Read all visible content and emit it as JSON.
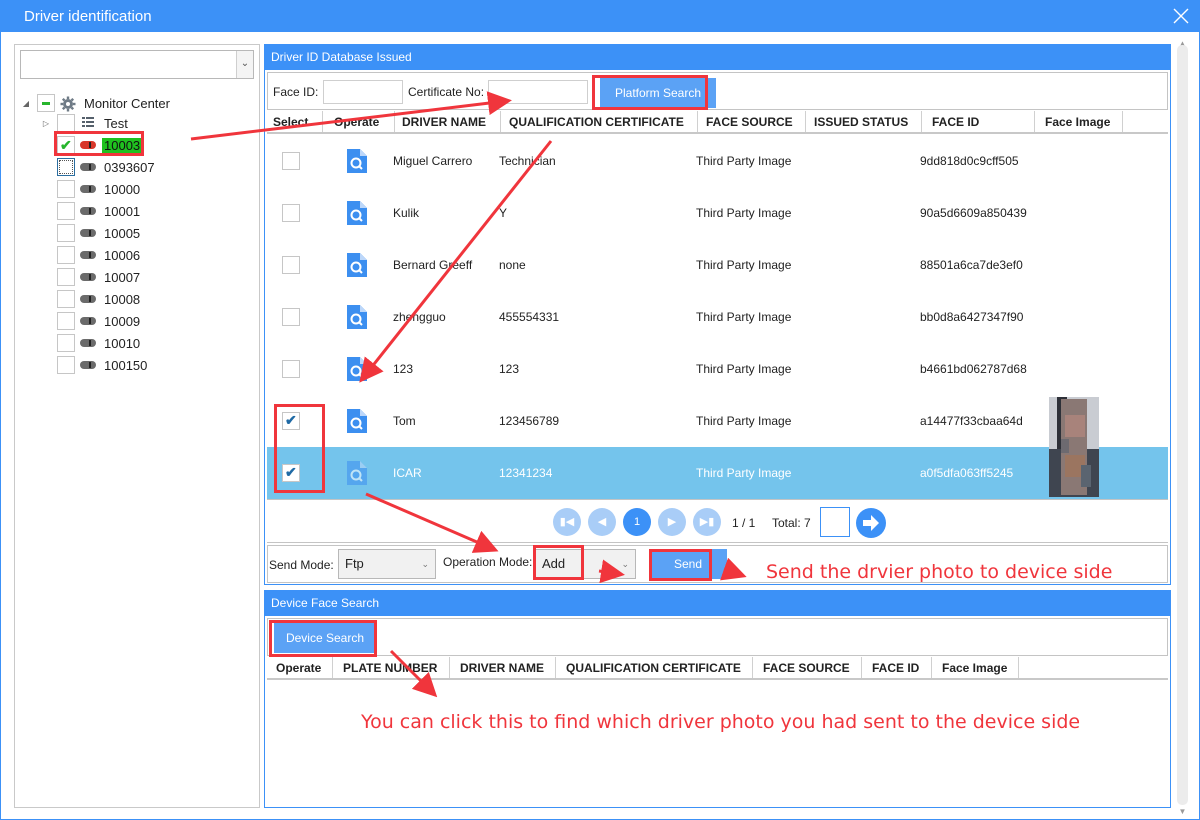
{
  "window": {
    "title": "Driver identification",
    "close_icon": "close-icon"
  },
  "left_panel": {
    "combo_value": "",
    "tree": {
      "root": {
        "label": "Monitor Center",
        "icon": "gear-icon",
        "state": "partial"
      },
      "items": [
        {
          "label": "Test",
          "icon": "list-icon",
          "state": "unchecked",
          "expandable": true
        },
        {
          "label": "10003",
          "icon": "car-icon-online",
          "state": "checked",
          "highlighted": true
        },
        {
          "label": "0393607",
          "icon": "car-icon",
          "state": "focused"
        },
        {
          "label": "10000",
          "icon": "car-icon",
          "state": "unchecked"
        },
        {
          "label": "10001",
          "icon": "car-icon",
          "state": "unchecked"
        },
        {
          "label": "10005",
          "icon": "car-icon",
          "state": "unchecked"
        },
        {
          "label": "10006",
          "icon": "car-icon",
          "state": "unchecked"
        },
        {
          "label": "10007",
          "icon": "car-icon",
          "state": "unchecked"
        },
        {
          "label": "10008",
          "icon": "car-icon",
          "state": "unchecked"
        },
        {
          "label": "10009",
          "icon": "car-icon",
          "state": "unchecked"
        },
        {
          "label": "10010",
          "icon": "car-icon",
          "state": "unchecked"
        },
        {
          "label": "100150",
          "icon": "car-icon",
          "state": "unchecked"
        }
      ]
    }
  },
  "db_panel": {
    "title": "Driver ID Database Issued",
    "face_id_label": "Face ID:",
    "face_id_value": "",
    "cert_label": "Certificate No:",
    "cert_value": "",
    "platform_search_label": "Platform Search",
    "columns": [
      "Select",
      "Operate",
      "DRIVER NAME",
      "QUALIFICATION CERTIFICATE",
      "FACE SOURCE",
      "ISSUED STATUS",
      "FACE ID",
      "Face Image"
    ],
    "rows": [
      {
        "checked": false,
        "name": "Miguel Carrero",
        "cert": "Technician",
        "source": "Third Party Image",
        "status": "",
        "face_id": "9dd818d0c9cff505",
        "has_image": false,
        "selected": false
      },
      {
        "checked": false,
        "name": "Kulik",
        "cert": "Y",
        "source": "Third Party Image",
        "status": "",
        "face_id": "90a5d6609a850439",
        "has_image": false,
        "selected": false
      },
      {
        "checked": false,
        "name": "Bernard Greeff",
        "cert": "none",
        "source": "Third Party Image",
        "status": "",
        "face_id": "88501a6ca7de3ef0",
        "has_image": false,
        "selected": false
      },
      {
        "checked": false,
        "name": "zhengguo",
        "cert": "455554331",
        "source": "Third Party Image",
        "status": "",
        "face_id": "bb0d8a6427347f90",
        "has_image": false,
        "selected": false
      },
      {
        "checked": false,
        "name": "123",
        "cert": "123",
        "source": "Third Party Image",
        "status": "",
        "face_id": "b4661bd062787d68",
        "has_image": false,
        "selected": false
      },
      {
        "checked": true,
        "name": "Tom",
        "cert": "123456789",
        "source": "Third Party Image",
        "status": "",
        "face_id": "a14477f33cbaa64d",
        "has_image": true,
        "selected": false
      },
      {
        "checked": true,
        "name": "ICAR",
        "cert": "12341234",
        "source": "Third Party Image",
        "status": "",
        "face_id": "a0f5dfa063ff5245",
        "has_image": true,
        "selected": true
      }
    ],
    "pager": {
      "current_page": "1",
      "page_text": "1  /  1",
      "total_text": "Total: 7",
      "jump_value": ""
    },
    "send_mode_label": "Send Mode:",
    "send_mode_value": "Ftp",
    "operation_mode_label": "Operation Mode:",
    "operation_mode_value": "Add",
    "send_label": "Send"
  },
  "device_panel": {
    "title": "Device Face Search",
    "device_search_label": "Device Search",
    "columns": [
      "Operate",
      "PLATE NUMBER",
      "DRIVER NAME",
      "QUALIFICATION CERTIFICATE",
      "FACE SOURCE",
      "FACE ID",
      "Face Image"
    ],
    "rows": []
  },
  "annotations": {
    "send_note": "Send the drvier photo to device side",
    "device_note": "You can click this to find which driver photo you had sent to the device side",
    "color": "#f0353c"
  },
  "colors": {
    "accent": "#3c91f7",
    "button": "#5ba2f5",
    "selected_row": "#74c4ec",
    "highlight_green": "#1fc11f"
  }
}
